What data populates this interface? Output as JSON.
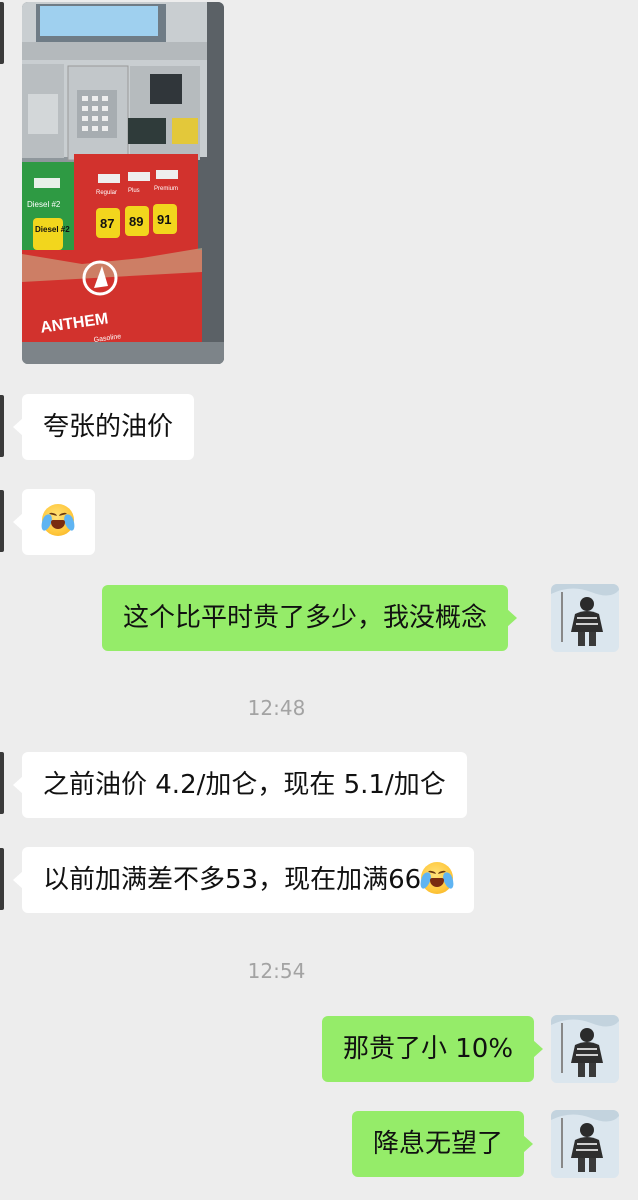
{
  "messages": {
    "m1": "夸张的油价",
    "m3": "这个比平时贵了多少，我没概念",
    "m4": "之前油价 4.2/加仑，现在 5.1/加仑",
    "m5": "以前加满差不多53，现在加满66",
    "m6": "那贵了小 10%",
    "m7": "降息无望了"
  },
  "timestamps": {
    "t1": "12:48",
    "t2": "12:54"
  },
  "photo": {
    "brand": "ANTHEM",
    "diesel_label": "Diesel #2",
    "grade_labels": [
      "Regular",
      "Plus",
      "Premium"
    ],
    "octanes": [
      "87",
      "89",
      "91"
    ],
    "diesel_button": "Diesel #2",
    "bottom_text": "Gasoline"
  },
  "icons": {
    "emoji": "loudly-crying-face-icon"
  },
  "colors": {
    "background": "#ededed",
    "incoming_bubble": "#ffffff",
    "outgoing_bubble": "#95ec69"
  }
}
